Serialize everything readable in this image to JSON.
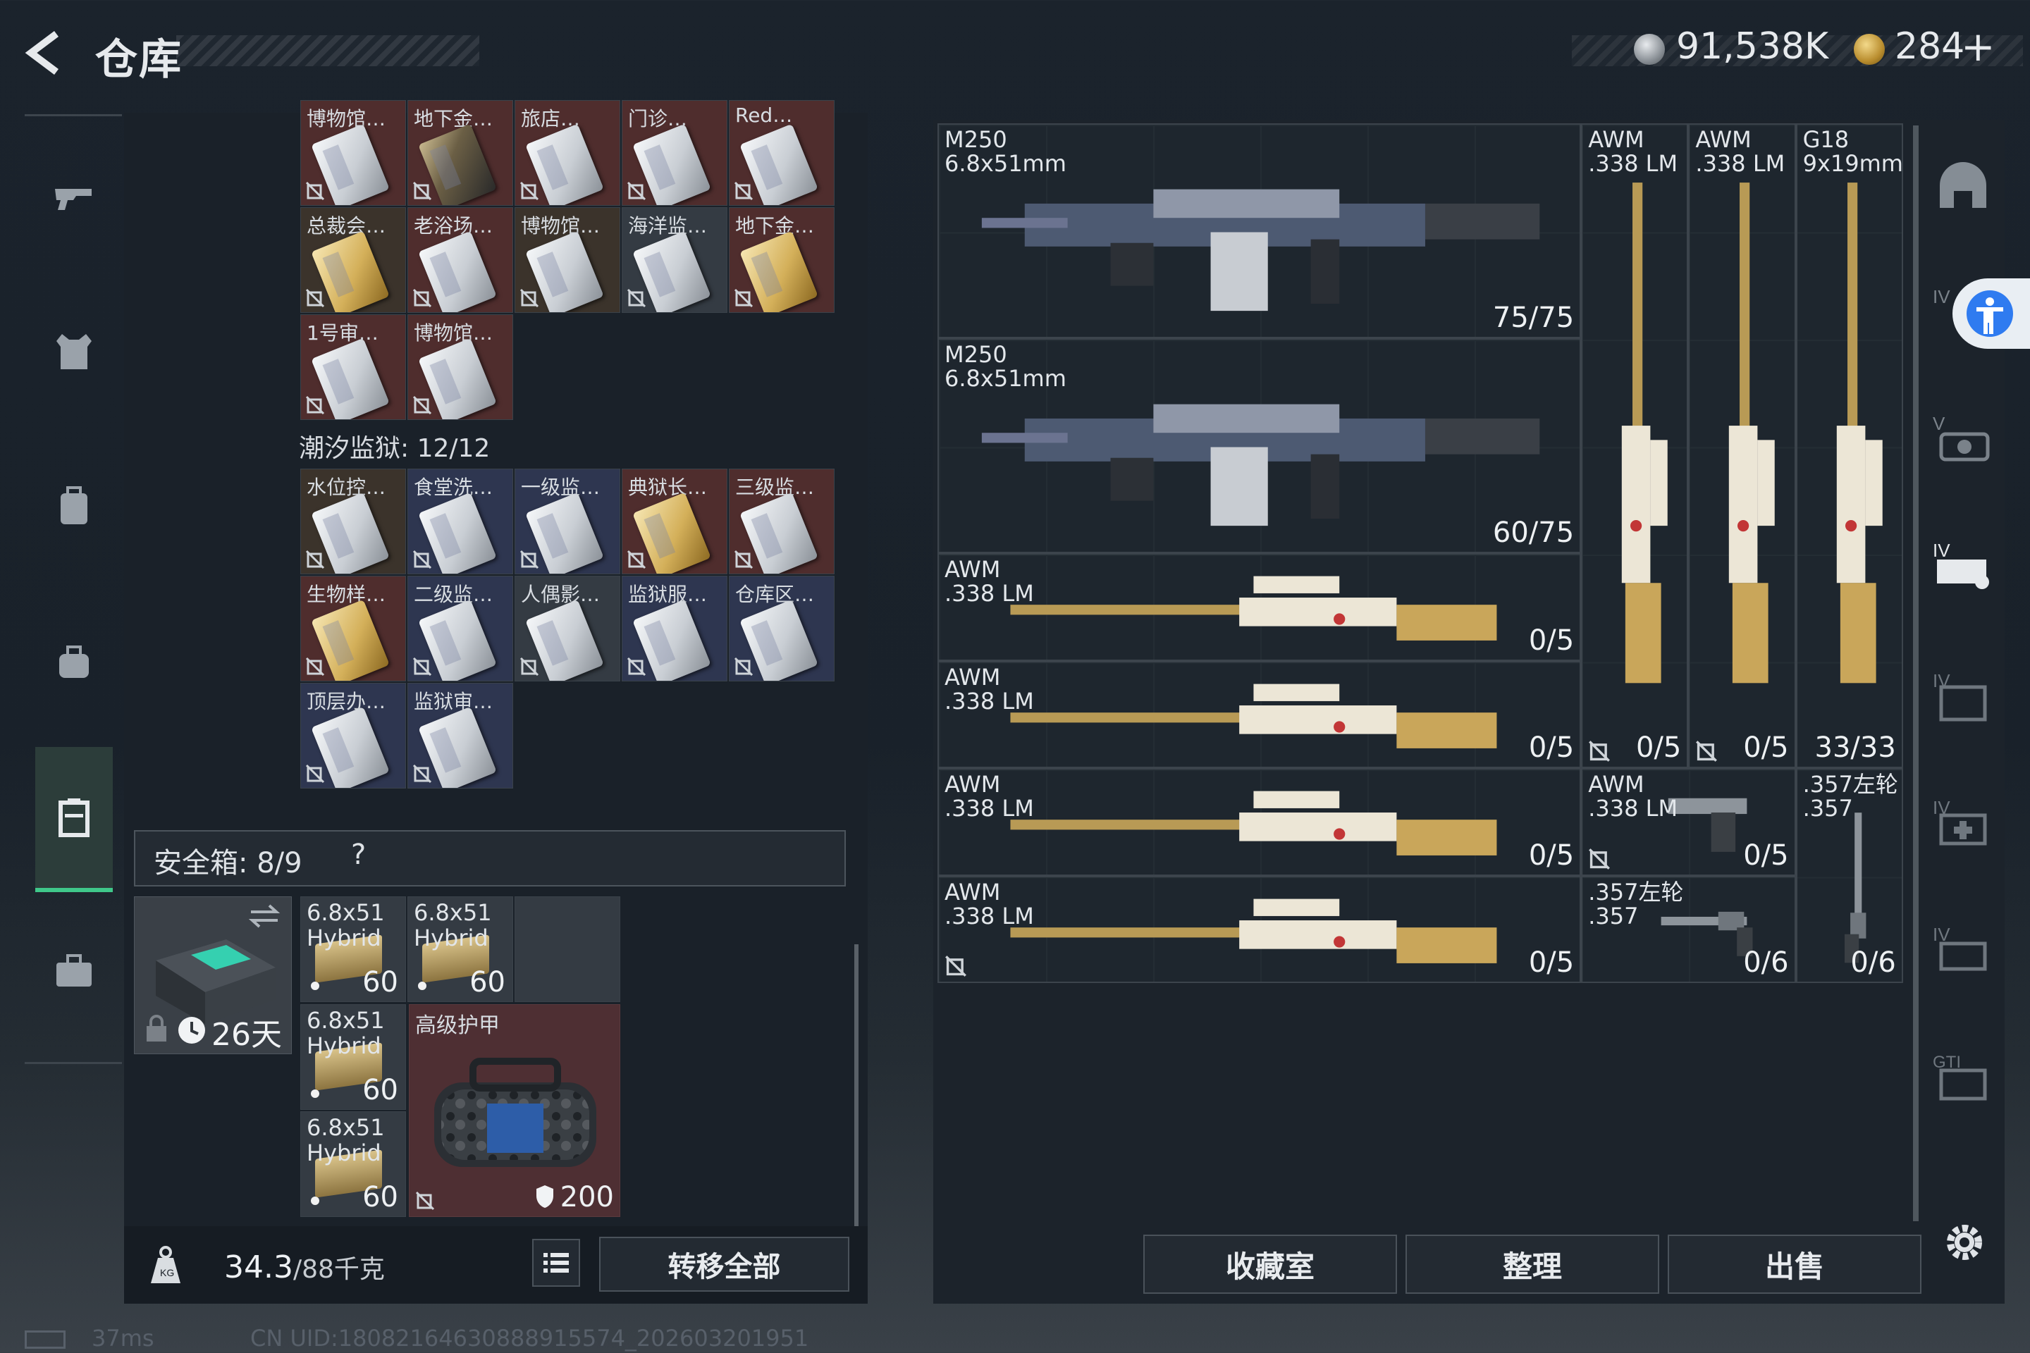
{
  "header": {
    "title": "仓库",
    "silver_amount": "91,538K",
    "gold_amount": "284",
    "gold_plus": "+"
  },
  "left_nav": {
    "items": [
      "pistol-icon",
      "vest-icon",
      "backpack-icon",
      "bag-icon",
      "case-icon",
      "briefcase-icon"
    ],
    "active": "case-icon"
  },
  "cards_top": [
    {
      "label": "博物馆…",
      "bg": "red",
      "card": "silver"
    },
    {
      "label": "地下金…",
      "bg": "red",
      "card": "dark"
    },
    {
      "label": "旅店…",
      "bg": "red",
      "card": "silver"
    },
    {
      "label": "门诊…",
      "bg": "red",
      "card": "silver"
    },
    {
      "label": "Red…",
      "bg": "red",
      "card": "silver"
    },
    {
      "label": "总裁会…",
      "bg": "brown",
      "card": "gold"
    },
    {
      "label": "老浴场…",
      "bg": "red",
      "card": "silver"
    },
    {
      "label": "博物馆…",
      "bg": "brown",
      "card": "silver"
    },
    {
      "label": "海洋监…",
      "bg": "gray",
      "card": "silver"
    },
    {
      "label": "地下金…",
      "bg": "red",
      "card": "gold"
    },
    {
      "label": "1号审…",
      "bg": "red",
      "card": "silver"
    },
    {
      "label": "博物馆…",
      "bg": "red",
      "card": "silver"
    }
  ],
  "section_label": "潮汐监狱: 12/12",
  "cards_prison": [
    {
      "label": "水位控…",
      "bg": "brown",
      "card": "silver"
    },
    {
      "label": "食堂洗…",
      "bg": "blue",
      "card": "silver"
    },
    {
      "label": "一级监…",
      "bg": "blue",
      "card": "silver"
    },
    {
      "label": "典狱长…",
      "bg": "red",
      "card": "gold"
    },
    {
      "label": "三级监…",
      "bg": "red",
      "card": "silver"
    },
    {
      "label": "生物样…",
      "bg": "red",
      "card": "gold"
    },
    {
      "label": "二级监…",
      "bg": "blue",
      "card": "silver"
    },
    {
      "label": "人偶影…",
      "bg": "gray",
      "card": "silver"
    },
    {
      "label": "监狱服…",
      "bg": "blue",
      "card": "silver"
    },
    {
      "label": "仓库区…",
      "bg": "blue",
      "card": "silver"
    },
    {
      "label": "顶层办…",
      "bg": "blue",
      "card": "silver"
    },
    {
      "label": "监狱审…",
      "bg": "blue",
      "card": "silver"
    }
  ],
  "safe": {
    "label": "安全箱: 8/9",
    "help": "?",
    "timer": "26天"
  },
  "safe_items": [
    {
      "label": "6.8x51\nHybrid",
      "count": "60"
    },
    {
      "label": "6.8x51\nHybrid",
      "count": "60"
    },
    {
      "label": "6.8x51\nHybrid",
      "count": "60"
    },
    {
      "label": "6.8x51\nHybrid",
      "count": "60"
    }
  ],
  "armor": {
    "label": "高级护甲",
    "durability": "200"
  },
  "bottom": {
    "weight": "34.3",
    "weight_unit": "/88千克",
    "transfer": "转移全部"
  },
  "weapons": [
    {
      "name": "M250\n6.8x51mm",
      "count": "75/75",
      "locked": false
    },
    {
      "name": "M250\n6.8x51mm",
      "count": "60/75",
      "locked": false
    },
    {
      "name": "AWM\n.338 LM",
      "count": "0/5",
      "locked": false
    },
    {
      "name": "AWM\n.338 LM",
      "count": "0/5",
      "locked": false
    },
    {
      "name": "AWM\n.338 LM",
      "count": "0/5",
      "locked": true
    },
    {
      "name": "AWM\n.338 LM",
      "count": "0/5",
      "locked": true
    },
    {
      "name": "AWM\n.338 LM",
      "count": "0/5",
      "locked": false
    },
    {
      "name": "AWM\n.338 LM",
      "count": "0/5",
      "locked": true
    },
    {
      "name": "AWM\n.338 LM",
      "count": "0/5",
      "locked": true
    },
    {
      "name": "G18\n9x19mm",
      "count": "33/33",
      "locked": false
    },
    {
      "name": ".357左轮\n.357",
      "count": "0/6",
      "locked": false
    },
    {
      "name": ".357左轮\n.357",
      "count": "0/6",
      "locked": false
    }
  ],
  "actions": {
    "collection": "收藏室",
    "organize": "整理",
    "sell": "出售"
  },
  "status": {
    "ping": "37ms",
    "uid": "CN UID:18082164630888915574_202603201951"
  },
  "colors": {
    "accent": "#3fc88a",
    "accessibility": "#2f7bf0"
  }
}
